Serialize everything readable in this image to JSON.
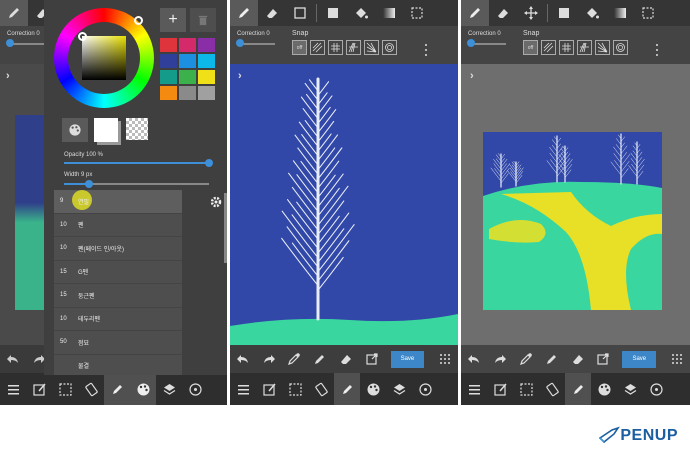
{
  "panels": {
    "p1": {
      "correction_label": "Correction 0",
      "opacity_label": "Opacity 100 %",
      "opacity_fraction": 1.0,
      "width_label": "Width 9 px",
      "width_fraction": 0.17,
      "brushes": [
        {
          "size": "9",
          "name": "연필"
        },
        {
          "size": "10",
          "name": "펜"
        },
        {
          "size": "10",
          "name": "펜(페이드 인/아웃)"
        },
        {
          "size": "15",
          "name": "G펜"
        },
        {
          "size": "15",
          "name": "둥근펜"
        },
        {
          "size": "10",
          "name": "테두리펜"
        },
        {
          "size": "50",
          "name": "점묘"
        },
        {
          "size": "",
          "name": "물결"
        }
      ]
    },
    "p2": {
      "correction_label": "Correction 0",
      "snap_label": "Snap",
      "snap_off_label": "off",
      "save_label": "Save"
    },
    "p3": {
      "correction_label": "Correction 0",
      "snap_label": "Snap",
      "snap_off_label": "off",
      "save_label": "Save"
    }
  },
  "colors": {
    "accent": "#3d87c8",
    "canvas_blue": "#3248a8",
    "canvas_green": "#3ad6a0",
    "highlight_yellow": "#c9c82c",
    "swatches": [
      "#e0343c",
      "#d42a6a",
      "#8a2ea8",
      "#30409a",
      "#1d8fe0",
      "#0bb8e8",
      "#149b8a",
      "#3cb04a",
      "#f0e018",
      "#f58a10",
      "#8a8a8a",
      "#a0a0a0"
    ]
  },
  "brand": {
    "logo_text": "PENUP"
  }
}
